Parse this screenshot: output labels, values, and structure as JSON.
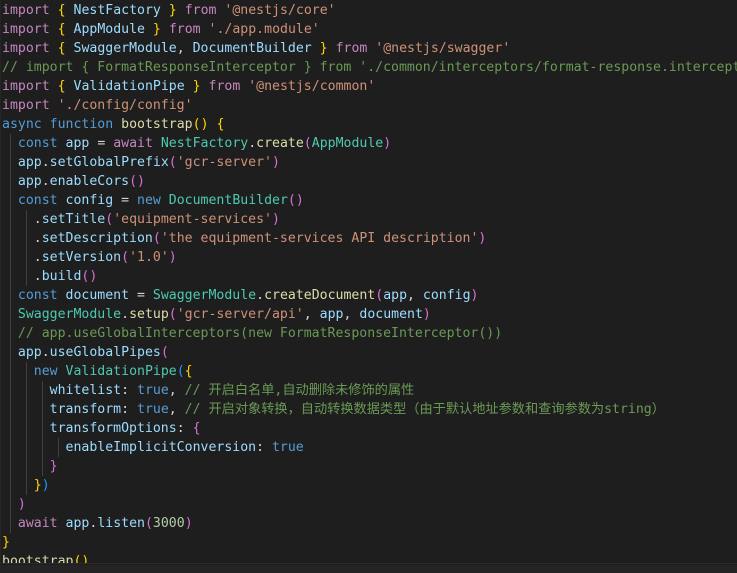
{
  "editor": {
    "language": "typescript",
    "theme": "dark-plus",
    "background_color": "#1e1e1e",
    "default_text_color": "#d4d4d4",
    "token_colors": {
      "keyword": "#c586c0",
      "control": "#569cd6",
      "identifier": "#9cdcfe",
      "class": "#4ec9b0",
      "function": "#dcdcaa",
      "string": "#ce9178",
      "number": "#b5cea8",
      "comment": "#6a9955",
      "bracket_level_1": "#ffd700",
      "bracket_level_2": "#da70d6",
      "bracket_level_3": "#179fff",
      "indent_guide": "#404040"
    },
    "scrollbar": {
      "orientation": "horizontal",
      "visible": true
    }
  },
  "code": {
    "lines": [
      {
        "n": 1,
        "guides": [],
        "tokens": [
          {
            "t": "import",
            "c": "t-keyword"
          },
          {
            "t": " ",
            "c": "t-plain"
          },
          {
            "t": "{",
            "c": "t-br-y"
          },
          {
            "t": " ",
            "c": "t-plain"
          },
          {
            "t": "NestFactory",
            "c": "t-ident"
          },
          {
            "t": " ",
            "c": "t-plain"
          },
          {
            "t": "}",
            "c": "t-br-y"
          },
          {
            "t": " ",
            "c": "t-plain"
          },
          {
            "t": "from",
            "c": "t-keyword"
          },
          {
            "t": " ",
            "c": "t-plain"
          },
          {
            "t": "'@nestjs/core'",
            "c": "t-string"
          }
        ]
      },
      {
        "n": 2,
        "guides": [],
        "tokens": [
          {
            "t": "import",
            "c": "t-keyword"
          },
          {
            "t": " ",
            "c": "t-plain"
          },
          {
            "t": "{",
            "c": "t-br-y"
          },
          {
            "t": " ",
            "c": "t-plain"
          },
          {
            "t": "AppModule",
            "c": "t-ident"
          },
          {
            "t": " ",
            "c": "t-plain"
          },
          {
            "t": "}",
            "c": "t-br-y"
          },
          {
            "t": " ",
            "c": "t-plain"
          },
          {
            "t": "from",
            "c": "t-keyword"
          },
          {
            "t": " ",
            "c": "t-plain"
          },
          {
            "t": "'./app.module'",
            "c": "t-string"
          }
        ]
      },
      {
        "n": 3,
        "guides": [],
        "tokens": [
          {
            "t": "import",
            "c": "t-keyword"
          },
          {
            "t": " ",
            "c": "t-plain"
          },
          {
            "t": "{",
            "c": "t-br-y"
          },
          {
            "t": " ",
            "c": "t-plain"
          },
          {
            "t": "SwaggerModule",
            "c": "t-ident"
          },
          {
            "t": ", ",
            "c": "t-plain"
          },
          {
            "t": "DocumentBuilder",
            "c": "t-ident"
          },
          {
            "t": " ",
            "c": "t-plain"
          },
          {
            "t": "}",
            "c": "t-br-y"
          },
          {
            "t": " ",
            "c": "t-plain"
          },
          {
            "t": "from",
            "c": "t-keyword"
          },
          {
            "t": " ",
            "c": "t-plain"
          },
          {
            "t": "'@nestjs/swagger'",
            "c": "t-string"
          }
        ]
      },
      {
        "n": 4,
        "guides": [],
        "tokens": [
          {
            "t": "// import { FormatResponseInterceptor } from './common/interceptors/format-response.interceptor'",
            "c": "t-comment"
          }
        ]
      },
      {
        "n": 5,
        "guides": [],
        "tokens": [
          {
            "t": "import",
            "c": "t-keyword"
          },
          {
            "t": " ",
            "c": "t-plain"
          },
          {
            "t": "{",
            "c": "t-br-y"
          },
          {
            "t": " ",
            "c": "t-plain"
          },
          {
            "t": "ValidationPipe",
            "c": "t-ident"
          },
          {
            "t": " ",
            "c": "t-plain"
          },
          {
            "t": "}",
            "c": "t-br-y"
          },
          {
            "t": " ",
            "c": "t-plain"
          },
          {
            "t": "from",
            "c": "t-keyword"
          },
          {
            "t": " ",
            "c": "t-plain"
          },
          {
            "t": "'@nestjs/common'",
            "c": "t-string"
          }
        ]
      },
      {
        "n": 6,
        "guides": [],
        "tokens": [
          {
            "t": "import",
            "c": "t-keyword"
          },
          {
            "t": " ",
            "c": "t-plain"
          },
          {
            "t": "'./config/config'",
            "c": "t-string"
          }
        ]
      },
      {
        "n": 7,
        "guides": [],
        "tokens": [
          {
            "t": "async",
            "c": "t-control"
          },
          {
            "t": " ",
            "c": "t-plain"
          },
          {
            "t": "function",
            "c": "t-control"
          },
          {
            "t": " ",
            "c": "t-plain"
          },
          {
            "t": "bootstrap",
            "c": "t-func"
          },
          {
            "t": "(",
            "c": "t-br-y"
          },
          {
            "t": ")",
            "c": "t-br-y"
          },
          {
            "t": " ",
            "c": "t-plain"
          },
          {
            "t": "{",
            "c": "t-br-y"
          }
        ]
      },
      {
        "n": 8,
        "guides": [
          8
        ],
        "tokens": [
          {
            "t": "  ",
            "c": "t-plain"
          },
          {
            "t": "const",
            "c": "t-control"
          },
          {
            "t": " ",
            "c": "t-plain"
          },
          {
            "t": "app",
            "c": "t-ident"
          },
          {
            "t": " = ",
            "c": "t-plain"
          },
          {
            "t": "await",
            "c": "t-keyword"
          },
          {
            "t": " ",
            "c": "t-plain"
          },
          {
            "t": "NestFactory",
            "c": "t-class"
          },
          {
            "t": ".",
            "c": "t-plain"
          },
          {
            "t": "create",
            "c": "t-func"
          },
          {
            "t": "(",
            "c": "t-br-m"
          },
          {
            "t": "AppModule",
            "c": "t-class"
          },
          {
            "t": ")",
            "c": "t-br-m"
          }
        ]
      },
      {
        "n": 9,
        "guides": [
          8
        ],
        "tokens": [
          {
            "t": "  ",
            "c": "t-plain"
          },
          {
            "t": "app",
            "c": "t-ident"
          },
          {
            "t": ".",
            "c": "t-plain"
          },
          {
            "t": "setGlobalPrefix",
            "c": "t-ident"
          },
          {
            "t": "(",
            "c": "t-br-m"
          },
          {
            "t": "'gcr-server'",
            "c": "t-string"
          },
          {
            "t": ")",
            "c": "t-br-m"
          }
        ]
      },
      {
        "n": 10,
        "guides": [
          8
        ],
        "tokens": [
          {
            "t": "  ",
            "c": "t-plain"
          },
          {
            "t": "app",
            "c": "t-ident"
          },
          {
            "t": ".",
            "c": "t-plain"
          },
          {
            "t": "enableCors",
            "c": "t-ident"
          },
          {
            "t": "(",
            "c": "t-br-m"
          },
          {
            "t": ")",
            "c": "t-br-m"
          }
        ]
      },
      {
        "n": 11,
        "guides": [
          8
        ],
        "tokens": [
          {
            "t": "  ",
            "c": "t-plain"
          },
          {
            "t": "const",
            "c": "t-control"
          },
          {
            "t": " ",
            "c": "t-plain"
          },
          {
            "t": "config",
            "c": "t-ident"
          },
          {
            "t": " = ",
            "c": "t-plain"
          },
          {
            "t": "new",
            "c": "t-control"
          },
          {
            "t": " ",
            "c": "t-plain"
          },
          {
            "t": "DocumentBuilder",
            "c": "t-class"
          },
          {
            "t": "(",
            "c": "t-br-m"
          },
          {
            "t": ")",
            "c": "t-br-m"
          }
        ]
      },
      {
        "n": 12,
        "guides": [
          8,
          24
        ],
        "tokens": [
          {
            "t": "    ",
            "c": "t-plain"
          },
          {
            "t": ".",
            "c": "t-plain"
          },
          {
            "t": "setTitle",
            "c": "t-ident"
          },
          {
            "t": "(",
            "c": "t-br-m"
          },
          {
            "t": "'equipment-services'",
            "c": "t-string"
          },
          {
            "t": ")",
            "c": "t-br-m"
          }
        ]
      },
      {
        "n": 13,
        "guides": [
          8,
          24
        ],
        "tokens": [
          {
            "t": "    ",
            "c": "t-plain"
          },
          {
            "t": ".",
            "c": "t-plain"
          },
          {
            "t": "setDescription",
            "c": "t-ident"
          },
          {
            "t": "(",
            "c": "t-br-m"
          },
          {
            "t": "'the equipment-services API description'",
            "c": "t-string"
          },
          {
            "t": ")",
            "c": "t-br-m"
          }
        ]
      },
      {
        "n": 14,
        "guides": [
          8,
          24
        ],
        "tokens": [
          {
            "t": "    ",
            "c": "t-plain"
          },
          {
            "t": ".",
            "c": "t-plain"
          },
          {
            "t": "setVersion",
            "c": "t-ident"
          },
          {
            "t": "(",
            "c": "t-br-m"
          },
          {
            "t": "'1.0'",
            "c": "t-string"
          },
          {
            "t": ")",
            "c": "t-br-m"
          }
        ]
      },
      {
        "n": 15,
        "guides": [
          8,
          24
        ],
        "tokens": [
          {
            "t": "    ",
            "c": "t-plain"
          },
          {
            "t": ".",
            "c": "t-plain"
          },
          {
            "t": "build",
            "c": "t-ident"
          },
          {
            "t": "(",
            "c": "t-br-m"
          },
          {
            "t": ")",
            "c": "t-br-m"
          }
        ]
      },
      {
        "n": 16,
        "guides": [
          8
        ],
        "tokens": [
          {
            "t": "  ",
            "c": "t-plain"
          },
          {
            "t": "const",
            "c": "t-control"
          },
          {
            "t": " ",
            "c": "t-plain"
          },
          {
            "t": "document",
            "c": "t-ident"
          },
          {
            "t": " = ",
            "c": "t-plain"
          },
          {
            "t": "SwaggerModule",
            "c": "t-class"
          },
          {
            "t": ".",
            "c": "t-plain"
          },
          {
            "t": "createDocument",
            "c": "t-func"
          },
          {
            "t": "(",
            "c": "t-br-m"
          },
          {
            "t": "app",
            "c": "t-ident"
          },
          {
            "t": ", ",
            "c": "t-plain"
          },
          {
            "t": "config",
            "c": "t-ident"
          },
          {
            "t": ")",
            "c": "t-br-m"
          }
        ]
      },
      {
        "n": 17,
        "guides": [
          8
        ],
        "tokens": [
          {
            "t": "  ",
            "c": "t-plain"
          },
          {
            "t": "SwaggerModule",
            "c": "t-class"
          },
          {
            "t": ".",
            "c": "t-plain"
          },
          {
            "t": "setup",
            "c": "t-func"
          },
          {
            "t": "(",
            "c": "t-br-m"
          },
          {
            "t": "'gcr-server/api'",
            "c": "t-string"
          },
          {
            "t": ", ",
            "c": "t-plain"
          },
          {
            "t": "app",
            "c": "t-ident"
          },
          {
            "t": ", ",
            "c": "t-plain"
          },
          {
            "t": "document",
            "c": "t-ident"
          },
          {
            "t": ")",
            "c": "t-br-m"
          }
        ]
      },
      {
        "n": 18,
        "guides": [
          8
        ],
        "tokens": [
          {
            "t": "  // app.useGlobalInterceptors(new FormatResponseInterceptor())",
            "c": "t-comment"
          }
        ]
      },
      {
        "n": 19,
        "guides": [
          8
        ],
        "tokens": [
          {
            "t": "  ",
            "c": "t-plain"
          },
          {
            "t": "app",
            "c": "t-ident"
          },
          {
            "t": ".",
            "c": "t-plain"
          },
          {
            "t": "useGlobalPipes",
            "c": "t-ident"
          },
          {
            "t": "(",
            "c": "t-br-m"
          }
        ]
      },
      {
        "n": 20,
        "guides": [
          8,
          24
        ],
        "tokens": [
          {
            "t": "    ",
            "c": "t-plain"
          },
          {
            "t": "new",
            "c": "t-control"
          },
          {
            "t": " ",
            "c": "t-plain"
          },
          {
            "t": "ValidationPipe",
            "c": "t-class"
          },
          {
            "t": "(",
            "c": "t-br-b"
          },
          {
            "t": "{",
            "c": "t-br-y"
          }
        ]
      },
      {
        "n": 21,
        "guides": [
          8,
          24,
          40
        ],
        "tokens": [
          {
            "t": "      ",
            "c": "t-plain"
          },
          {
            "t": "whitelist",
            "c": "t-ident"
          },
          {
            "t": ": ",
            "c": "t-plain"
          },
          {
            "t": "true",
            "c": "t-control"
          },
          {
            "t": ",",
            "c": "t-plain"
          },
          {
            "t": " ",
            "c": "t-plain"
          },
          {
            "t": "// 开启白名单,自动删除未修饰的属性",
            "c": "t-comment"
          }
        ]
      },
      {
        "n": 22,
        "guides": [
          8,
          24,
          40
        ],
        "tokens": [
          {
            "t": "      ",
            "c": "t-plain"
          },
          {
            "t": "transform",
            "c": "t-ident"
          },
          {
            "t": ": ",
            "c": "t-plain"
          },
          {
            "t": "true",
            "c": "t-control"
          },
          {
            "t": ",",
            "c": "t-plain"
          },
          {
            "t": " ",
            "c": "t-plain"
          },
          {
            "t": "// 开启对象转换，自动转换数据类型（由于默认地址参数和查询参数为string）",
            "c": "t-comment"
          }
        ]
      },
      {
        "n": 23,
        "guides": [
          8,
          24,
          40
        ],
        "tokens": [
          {
            "t": "      ",
            "c": "t-plain"
          },
          {
            "t": "transformOptions",
            "c": "t-ident"
          },
          {
            "t": ": ",
            "c": "t-plain"
          },
          {
            "t": "{",
            "c": "t-br-m"
          }
        ]
      },
      {
        "n": 24,
        "guides": [
          8,
          24,
          40,
          56
        ],
        "tokens": [
          {
            "t": "        ",
            "c": "t-plain"
          },
          {
            "t": "enableImplicitConversion",
            "c": "t-ident"
          },
          {
            "t": ": ",
            "c": "t-plain"
          },
          {
            "t": "true",
            "c": "t-control"
          }
        ]
      },
      {
        "n": 25,
        "guides": [
          8,
          24,
          40
        ],
        "tokens": [
          {
            "t": "      ",
            "c": "t-plain"
          },
          {
            "t": "}",
            "c": "t-br-m"
          }
        ]
      },
      {
        "n": 26,
        "guides": [
          8,
          24
        ],
        "tokens": [
          {
            "t": "    ",
            "c": "t-plain"
          },
          {
            "t": "}",
            "c": "t-br-y"
          },
          {
            "t": ")",
            "c": "t-br-b"
          }
        ]
      },
      {
        "n": 27,
        "guides": [
          8
        ],
        "tokens": [
          {
            "t": "  ",
            "c": "t-plain"
          },
          {
            "t": ")",
            "c": "t-br-m"
          }
        ]
      },
      {
        "n": 28,
        "guides": [
          8
        ],
        "tokens": [
          {
            "t": "  ",
            "c": "t-plain"
          },
          {
            "t": "await",
            "c": "t-keyword"
          },
          {
            "t": " ",
            "c": "t-plain"
          },
          {
            "t": "app",
            "c": "t-ident"
          },
          {
            "t": ".",
            "c": "t-plain"
          },
          {
            "t": "listen",
            "c": "t-ident"
          },
          {
            "t": "(",
            "c": "t-br-m"
          },
          {
            "t": "3000",
            "c": "t-number"
          },
          {
            "t": ")",
            "c": "t-br-m"
          }
        ]
      },
      {
        "n": 29,
        "guides": [],
        "tokens": [
          {
            "t": "}",
            "c": "t-br-y"
          }
        ]
      },
      {
        "n": 30,
        "guides": [],
        "tokens": [
          {
            "t": "bootstrap",
            "c": "t-func"
          },
          {
            "t": "(",
            "c": "t-br-y"
          },
          {
            "t": ")",
            "c": "t-br-y"
          }
        ]
      }
    ]
  }
}
